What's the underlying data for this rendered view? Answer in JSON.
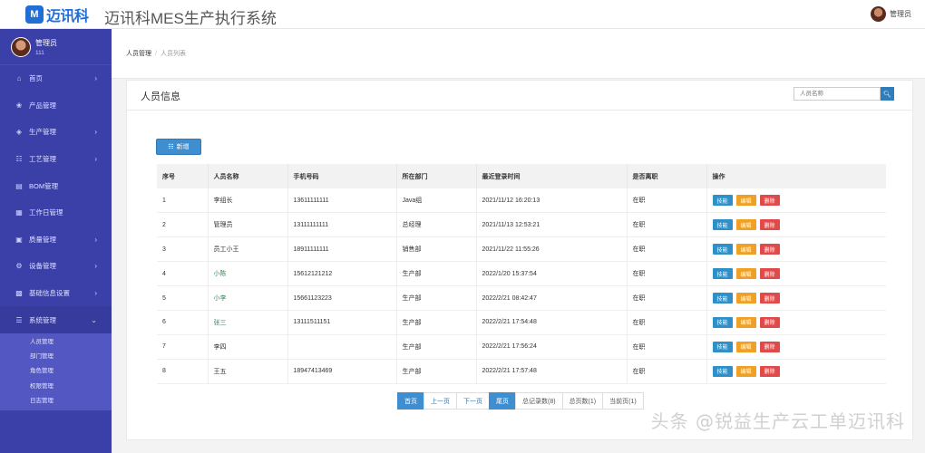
{
  "header": {
    "logo_mark": "M",
    "logo_text": "迈讯科",
    "system_title": "迈讯科MES生产执行系统",
    "user_name": "管理员"
  },
  "sidebar": {
    "profile_name": "管理员",
    "profile_id": "111",
    "items": [
      {
        "label": "首页",
        "icon": "home-icon",
        "has_arrow": true
      },
      {
        "label": "产品管理",
        "icon": "product-icon",
        "has_arrow": false
      },
      {
        "label": "生产管理",
        "icon": "production-icon",
        "has_arrow": true
      },
      {
        "label": "工艺管理",
        "icon": "process-icon",
        "has_arrow": true
      },
      {
        "label": "BOM管理",
        "icon": "bom-icon",
        "has_arrow": false
      },
      {
        "label": "工作日管理",
        "icon": "calendar-icon",
        "has_arrow": false
      },
      {
        "label": "质量管理",
        "icon": "quality-icon",
        "has_arrow": true
      },
      {
        "label": "设备管理",
        "icon": "equipment-icon",
        "has_arrow": true
      },
      {
        "label": "基础信息设置",
        "icon": "settings-icon",
        "has_arrow": true
      },
      {
        "label": "系统管理",
        "icon": "system-icon",
        "has_arrow": true,
        "open": true
      }
    ],
    "submenu": [
      "人员管理",
      "部门管理",
      "角色管理",
      "权限管理",
      "日志管理"
    ]
  },
  "breadcrumb": {
    "home": "人员管理",
    "separator": "/",
    "current": "人员列表"
  },
  "panel": {
    "title": "人员信息",
    "search_placeholder": "人员名称",
    "add_label": "新增"
  },
  "table": {
    "headers": [
      "序号",
      "人员名称",
      "手机号码",
      "所在部门",
      "最近登录时间",
      "是否离职",
      "操作"
    ],
    "rows": [
      {
        "no": "1",
        "name": "李组长",
        "phone": "13611111111",
        "dept": "Java组",
        "login": "2021/11/12 16:20:13",
        "status": "在职",
        "link": false
      },
      {
        "no": "2",
        "name": "管理员",
        "phone": "13111111111",
        "dept": "总经理",
        "login": "2021/11/13 12:53:21",
        "status": "在职",
        "link": false
      },
      {
        "no": "3",
        "name": "员工小王",
        "phone": "18911111111",
        "dept": "销售部",
        "login": "2021/11/22 11:55:26",
        "status": "在职",
        "link": false
      },
      {
        "no": "4",
        "name": "小陈",
        "phone": "15612121212",
        "dept": "生产部",
        "login": "2022/1/20 15:37:54",
        "status": "在职",
        "link": true
      },
      {
        "no": "5",
        "name": "小李",
        "phone": "15661123223",
        "dept": "生产部",
        "login": "2022/2/21 08:42:47",
        "status": "在职",
        "link": true
      },
      {
        "no": "6",
        "name": "张三",
        "phone": "13111511151",
        "dept": "生产部",
        "login": "2022/2/21 17:54:48",
        "status": "在职",
        "link": true
      },
      {
        "no": "7",
        "name": "李四",
        "phone": "",
        "dept": "生产部",
        "login": "2022/2/21 17:56:24",
        "status": "在职",
        "link": false
      },
      {
        "no": "8",
        "name": "王五",
        "phone": "18947413469",
        "dept": "生产部",
        "login": "2022/2/21 17:57:48",
        "status": "在职",
        "link": false
      }
    ],
    "op_labels": {
      "skill": "技能",
      "edit": "编辑",
      "delete": "删除"
    }
  },
  "pager": {
    "first": "首页",
    "prev": "上一页",
    "next": "下一页",
    "last": "尾页",
    "total_records": "总记录数(8)",
    "total_pages": "总页数(1)",
    "current_page": "当前页(1)"
  },
  "watermark": "头条 @锐益生产云工单迈讯科",
  "colors": {
    "sidebar": "#3b3fa8",
    "primary": "#3f8fd0",
    "edit": "#f0a024",
    "delete": "#e04a4a"
  }
}
